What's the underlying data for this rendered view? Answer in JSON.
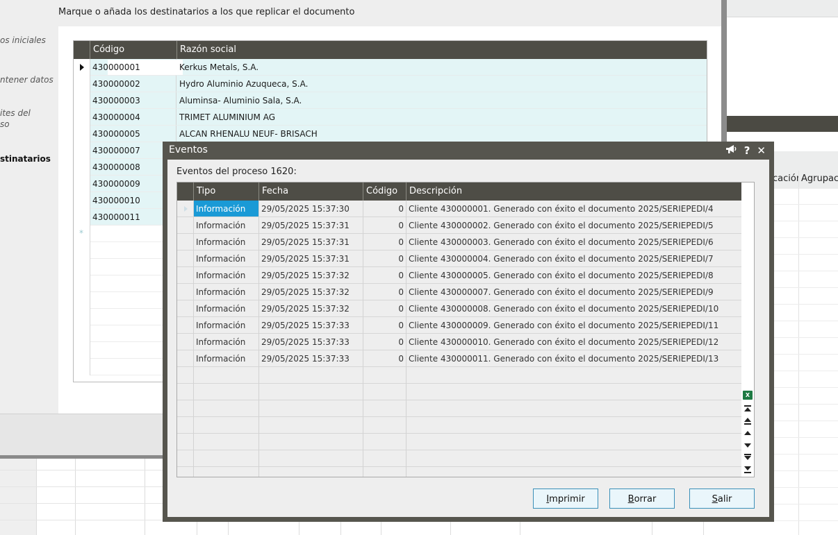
{
  "wizard": {
    "header_title_partial": "Destinatarios",
    "subtitle": "Marque o añada los destinatarios a los que replicar el documento",
    "side_items": [
      {
        "label": "os iniciales",
        "bold": false
      },
      {
        "label": "ntener datos",
        "bold": false
      },
      {
        "label": "ites del",
        "bold": false
      },
      {
        "label": "so",
        "bold": false
      },
      {
        "label": "stinatarios",
        "bold": true
      }
    ],
    "grid": {
      "columns": [
        "Código",
        "Razón social"
      ],
      "rows": [
        {
          "codigo": "430000001",
          "razon": "Kerkus Metals, S.A."
        },
        {
          "codigo": "430000002",
          "razon": "Hydro Aluminio Azuqueca, S.A."
        },
        {
          "codigo": "430000003",
          "razon": "Aluminsa- Aluminio Sala, S.A."
        },
        {
          "codigo": "430000004",
          "razon": "TRIMET ALUMINIUM AG"
        },
        {
          "codigo": "430000005",
          "razon": "ALCAN RHENALU NEUF- BRISACH"
        },
        {
          "codigo": "430000007",
          "razon": ""
        },
        {
          "codigo": "430000008",
          "razon": ""
        },
        {
          "codigo": "430000009",
          "razon": ""
        },
        {
          "codigo": "430000010",
          "razon": ""
        },
        {
          "codigo": "430000011",
          "razon": ""
        }
      ],
      "new_row_marker": "*"
    }
  },
  "background_grid": {
    "columns": [
      "cación",
      "Agrupaci"
    ]
  },
  "eventos": {
    "title": "Eventos",
    "label": "Eventos del proceso 1620:",
    "columns": {
      "tipo": "Tipo",
      "fecha": "Fecha",
      "codigo": "Código",
      "descripcion": "Descripción"
    },
    "rows": [
      {
        "tipo": "Información",
        "fecha": "29/05/2025 15:37:30",
        "codigo": "0",
        "descripcion": "Cliente 430000001. Generado con éxito el documento 2025/SERIEPEDI/4"
      },
      {
        "tipo": "Información",
        "fecha": "29/05/2025 15:37:31",
        "codigo": "0",
        "descripcion": "Cliente 430000002. Generado con éxito el documento 2025/SERIEPEDI/5"
      },
      {
        "tipo": "Información",
        "fecha": "29/05/2025 15:37:31",
        "codigo": "0",
        "descripcion": "Cliente 430000003. Generado con éxito el documento 2025/SERIEPEDI/6"
      },
      {
        "tipo": "Información",
        "fecha": "29/05/2025 15:37:31",
        "codigo": "0",
        "descripcion": "Cliente 430000004. Generado con éxito el documento 2025/SERIEPEDI/7"
      },
      {
        "tipo": "Información",
        "fecha": "29/05/2025 15:37:32",
        "codigo": "0",
        "descripcion": "Cliente 430000005. Generado con éxito el documento 2025/SERIEPEDI/8"
      },
      {
        "tipo": "Información",
        "fecha": "29/05/2025 15:37:32",
        "codigo": "0",
        "descripcion": "Cliente 430000007. Generado con éxito el documento 2025/SERIEPEDI/9"
      },
      {
        "tipo": "Información",
        "fecha": "29/05/2025 15:37:32",
        "codigo": "0",
        "descripcion": "Cliente 430000008. Generado con éxito el documento 2025/SERIEPEDI/10"
      },
      {
        "tipo": "Información",
        "fecha": "29/05/2025 15:37:33",
        "codigo": "0",
        "descripcion": "Cliente 430000009. Generado con éxito el documento 2025/SERIEPEDI/11"
      },
      {
        "tipo": "Información",
        "fecha": "29/05/2025 15:37:33",
        "codigo": "0",
        "descripcion": "Cliente 430000010. Generado con éxito el documento 2025/SERIEPEDI/12"
      },
      {
        "tipo": "Información",
        "fecha": "29/05/2025 15:37:33",
        "codigo": "0",
        "descripcion": "Cliente 430000011. Generado con éxito el documento 2025/SERIEPEDI/13"
      }
    ],
    "buttons": {
      "imprimir": {
        "underline": "I",
        "rest": "mprimir"
      },
      "borrar": {
        "underline": "B",
        "rest": "orrar"
      },
      "salir": {
        "underline": "S",
        "rest": "alir"
      }
    },
    "icons": [
      "announce-icon",
      "help-icon",
      "close-icon",
      "excel-export-icon",
      "scroll-first-icon",
      "scroll-page-up-icon",
      "scroll-up-icon",
      "scroll-down-icon",
      "scroll-page-down-icon",
      "scroll-last-icon"
    ],
    "colors": {
      "title_bar": "#56554e",
      "grid_header": "#4e4d46",
      "selected_cell": "#1a9ad6",
      "row_fill": "#e3f5f6",
      "button_border": "#3a8fb8"
    }
  }
}
